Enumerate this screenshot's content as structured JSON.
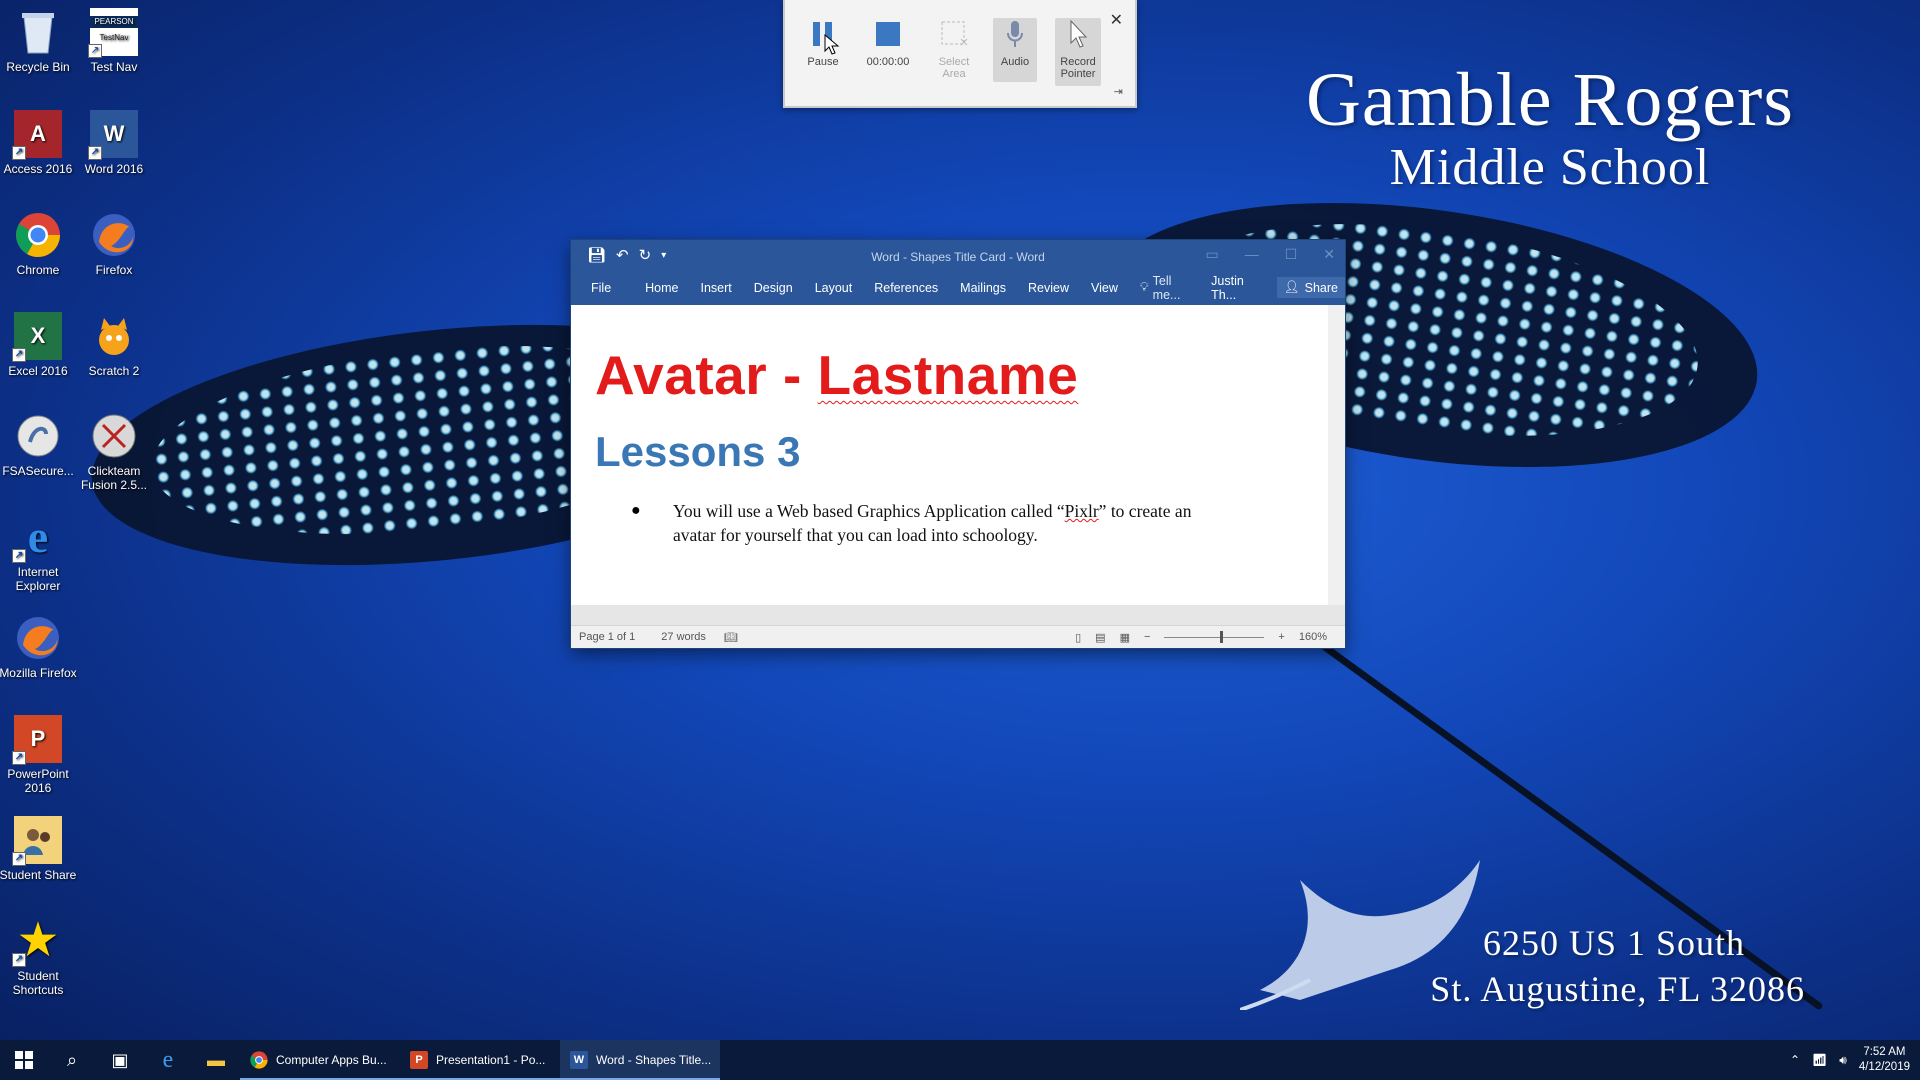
{
  "wallpaper": {
    "school_line1": "Gamble Rogers",
    "school_line2": "Middle School",
    "address_line1": "6250 US 1 South",
    "address_line2": "St. Augustine, FL 32086"
  },
  "desktop_icons": [
    {
      "label": "Recycle Bin",
      "icon": "recycle-bin-icon"
    },
    {
      "label": "Test Nav",
      "icon": "testnav-icon",
      "brand": "PEARSON",
      "inner": "TestNav"
    },
    {
      "label": "Access 2016",
      "icon": "access-icon"
    },
    {
      "label": "Word 2016",
      "icon": "word-icon"
    },
    {
      "label": "Chrome",
      "icon": "chrome-icon"
    },
    {
      "label": "Firefox",
      "icon": "firefox-icon"
    },
    {
      "label": "Excel 2016",
      "icon": "excel-icon"
    },
    {
      "label": "Scratch 2",
      "icon": "scratch-icon"
    },
    {
      "label": "FSASecure...",
      "icon": "fsasecure-icon"
    },
    {
      "label": "Clickteam Fusion 2.5...",
      "icon": "clickteam-icon"
    },
    {
      "label": "Internet Explorer",
      "icon": "internet-explorer-icon"
    },
    {
      "label": "Mozilla Firefox",
      "icon": "mozilla-firefox-icon"
    },
    {
      "label": "PowerPoint 2016",
      "icon": "powerpoint-icon"
    },
    {
      "label": "Student Share",
      "icon": "student-share-icon"
    },
    {
      "label": "Student Shortcuts",
      "icon": "star-icon"
    }
  ],
  "recorder": {
    "pause_label": "Pause",
    "timer": "00:00:00",
    "select_area_label": "Select Area",
    "audio_label": "Audio",
    "record_pointer_label": "Record Pointer"
  },
  "word": {
    "title": "Word - Shapes Title Card - Word",
    "tabs": {
      "file": "File",
      "home": "Home",
      "insert": "Insert",
      "design": "Design",
      "layout": "Layout",
      "references": "References",
      "mailings": "Mailings",
      "review": "Review",
      "view": "View"
    },
    "tell_me": "Tell me...",
    "user": "Justin Th...",
    "share": "Share",
    "doc": {
      "title_part1": "Avatar - ",
      "title_part2": "Lastname",
      "subtitle": "Lessons 3",
      "bullet_before": "You will use a Web based Graphics Application called “",
      "bullet_word": "Pixlr",
      "bullet_after": "” to create an avatar for yourself that you can load into schoology."
    },
    "status": {
      "page": "Page 1 of 1",
      "words": "27 words",
      "zoom": "160%"
    }
  },
  "taskbar": {
    "apps": [
      {
        "label": "Computer Apps Bu...",
        "icon": "chrome-icon"
      },
      {
        "label": "Presentation1 - Po...",
        "icon": "powerpoint-icon"
      },
      {
        "label": "Word - Shapes Title...",
        "icon": "word-icon"
      }
    ],
    "time": "7:52 AM",
    "date": "4/12/2019"
  },
  "colors": {
    "word_blue": "#2b579a",
    "title_red": "#e31b1b",
    "heading_blue": "#3a77b5"
  }
}
